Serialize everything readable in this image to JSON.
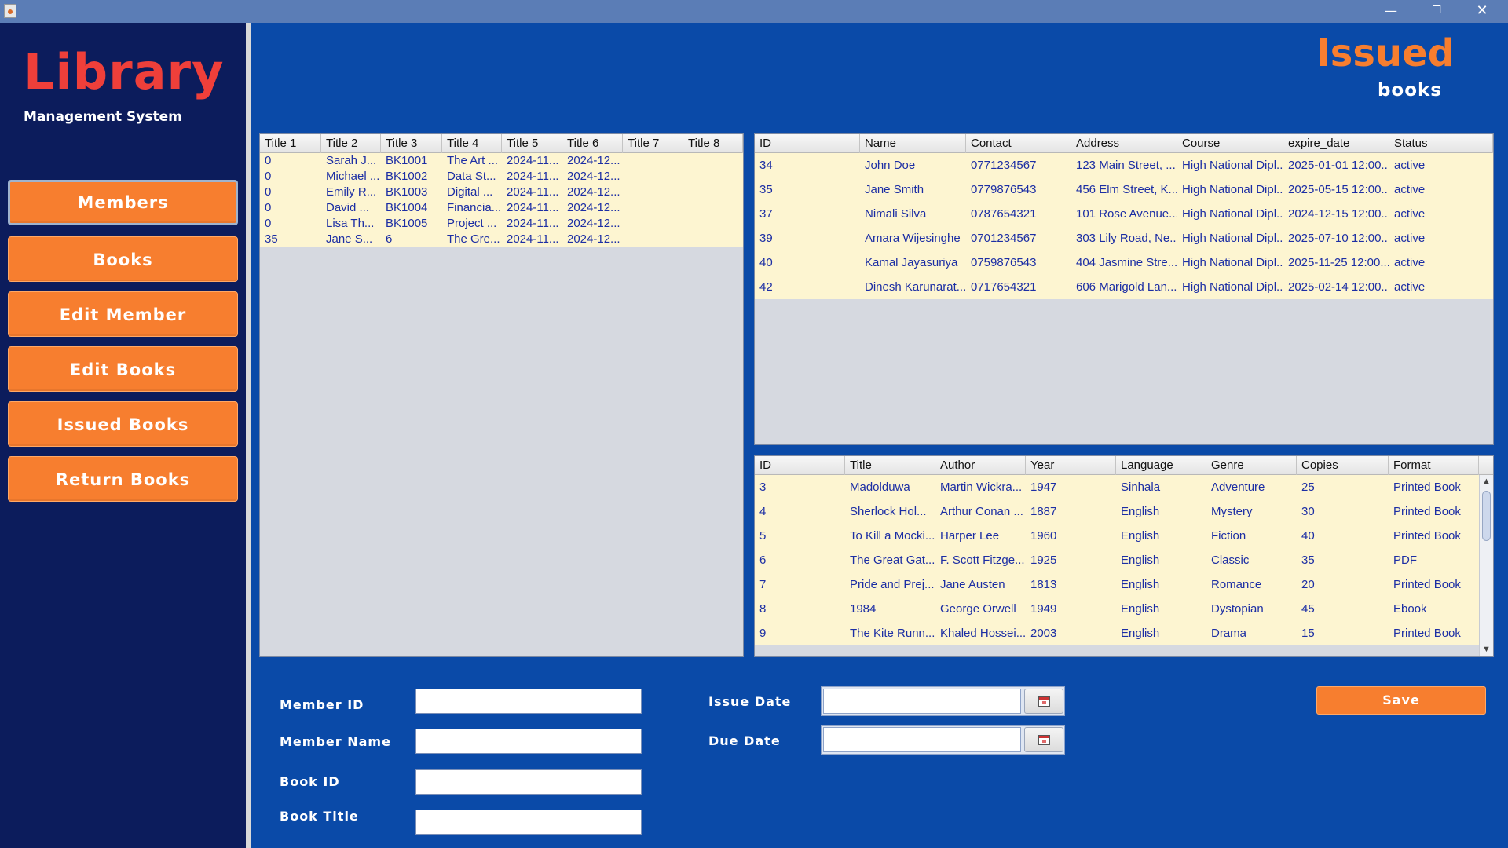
{
  "window": {
    "controls": {
      "minimize": "—",
      "maximize": "❐",
      "close": "✕"
    }
  },
  "sidebar": {
    "logo_title": "Library",
    "logo_subtitle": "Management System",
    "nav": [
      {
        "label": "Members"
      },
      {
        "label": "Books"
      },
      {
        "label": "Edit Member"
      },
      {
        "label": "Edit Books"
      },
      {
        "label": "Issued Books"
      },
      {
        "label": "Return Books"
      }
    ]
  },
  "header": {
    "title": "Issued",
    "subtitle": "books"
  },
  "issued_table": {
    "columns": [
      "Title 1",
      "Title 2",
      "Title 3",
      "Title 4",
      "Title 5",
      "Title 6",
      "Title 7",
      "Title 8"
    ],
    "rows": [
      [
        "0",
        "Sarah J...",
        "BK1001",
        "The Art ...",
        "2024-11...",
        "2024-12...",
        "",
        ""
      ],
      [
        "0",
        "Michael ...",
        "BK1002",
        "Data St...",
        "2024-11...",
        "2024-12...",
        "",
        ""
      ],
      [
        "0",
        "Emily R...",
        "BK1003",
        "Digital ...",
        "2024-11...",
        "2024-12...",
        "",
        ""
      ],
      [
        "0",
        "David ...",
        "BK1004",
        "Financia...",
        "2024-11...",
        "2024-12...",
        "",
        ""
      ],
      [
        "0",
        "Lisa Th...",
        "BK1005",
        "Project ...",
        "2024-11...",
        "2024-12...",
        "",
        ""
      ],
      [
        "35",
        "Jane S...",
        "6",
        "The Gre...",
        "2024-11...",
        "2024-12...",
        "",
        ""
      ]
    ]
  },
  "members_table": {
    "columns": [
      "ID",
      "Name",
      "Contact",
      "Address",
      "Course",
      "expire_date",
      "Status"
    ],
    "rows": [
      [
        "34",
        "John Doe",
        "0771234567",
        "123 Main Street, ...",
        "High National Dipl...",
        "2025-01-01 12:00...",
        "active"
      ],
      [
        "35",
        "Jane Smith",
        "0779876543",
        "456 Elm Street, K...",
        "High National Dipl...",
        "2025-05-15 12:00...",
        "active"
      ],
      [
        "37",
        "Nimali Silva",
        "0787654321",
        "101 Rose Avenue...",
        "High National Dipl...",
        "2024-12-15 12:00...",
        "active"
      ],
      [
        "39",
        "Amara Wijesinghe",
        "0701234567",
        "303 Lily Road, Ne...",
        "High National Dipl...",
        "2025-07-10 12:00...",
        "active"
      ],
      [
        "40",
        "Kamal Jayasuriya",
        "0759876543",
        "404 Jasmine Stre...",
        "High National Dipl...",
        "2025-11-25 12:00...",
        "active"
      ],
      [
        "42",
        "Dinesh Karunarat...",
        "0717654321",
        "606 Marigold Lan...",
        "High National Dipl...",
        "2025-02-14 12:00...",
        "active"
      ]
    ]
  },
  "books_table": {
    "columns": [
      "ID",
      "Title",
      "Author",
      "Year",
      "Language",
      "Genre",
      "Copies",
      "Format"
    ],
    "rows": [
      [
        "3",
        "Madolduwa",
        "Martin Wickra...",
        "1947",
        "Sinhala",
        "Adventure",
        "25",
        "Printed Book"
      ],
      [
        "4",
        "Sherlock Hol...",
        "Arthur Conan ...",
        "1887",
        "English",
        "Mystery",
        "30",
        "Printed Book"
      ],
      [
        "5",
        "To Kill a Mocki...",
        "Harper Lee",
        "1960",
        "English",
        "Fiction",
        "40",
        "Printed Book"
      ],
      [
        "6",
        "The Great Gat...",
        "F. Scott Fitzge...",
        "1925",
        "English",
        "Classic",
        "35",
        "PDF"
      ],
      [
        "7",
        "Pride and Prej...",
        "Jane Austen",
        "1813",
        "English",
        "Romance",
        "20",
        "Printed Book"
      ],
      [
        "8",
        "1984",
        "George Orwell",
        "1949",
        "English",
        "Dystopian",
        "45",
        "Ebook"
      ],
      [
        "9",
        "The Kite Runn...",
        "Khaled Hossei...",
        "2003",
        "English",
        "Drama",
        "15",
        "Printed Book"
      ]
    ],
    "scroll_up": "▲",
    "scroll_down": "▼"
  },
  "form": {
    "member_id": {
      "label": "Member ID",
      "value": ""
    },
    "member_name": {
      "label": "Member Name",
      "value": ""
    },
    "book_id": {
      "label": "Book ID",
      "value": ""
    },
    "book_title": {
      "label": "Book Title",
      "value": ""
    },
    "issue_date": {
      "label": "Issue Date",
      "value": ""
    },
    "due_date": {
      "label": "Due Date",
      "value": ""
    },
    "save_label": "Save"
  },
  "colors": {
    "background": "#0a4aa8",
    "sidebar": "#0c1c5c",
    "accent": "#f77e2f",
    "logo": "#ef3f3a",
    "row_fill": "#fdf5d1",
    "row_text": "#1c2ea4"
  }
}
